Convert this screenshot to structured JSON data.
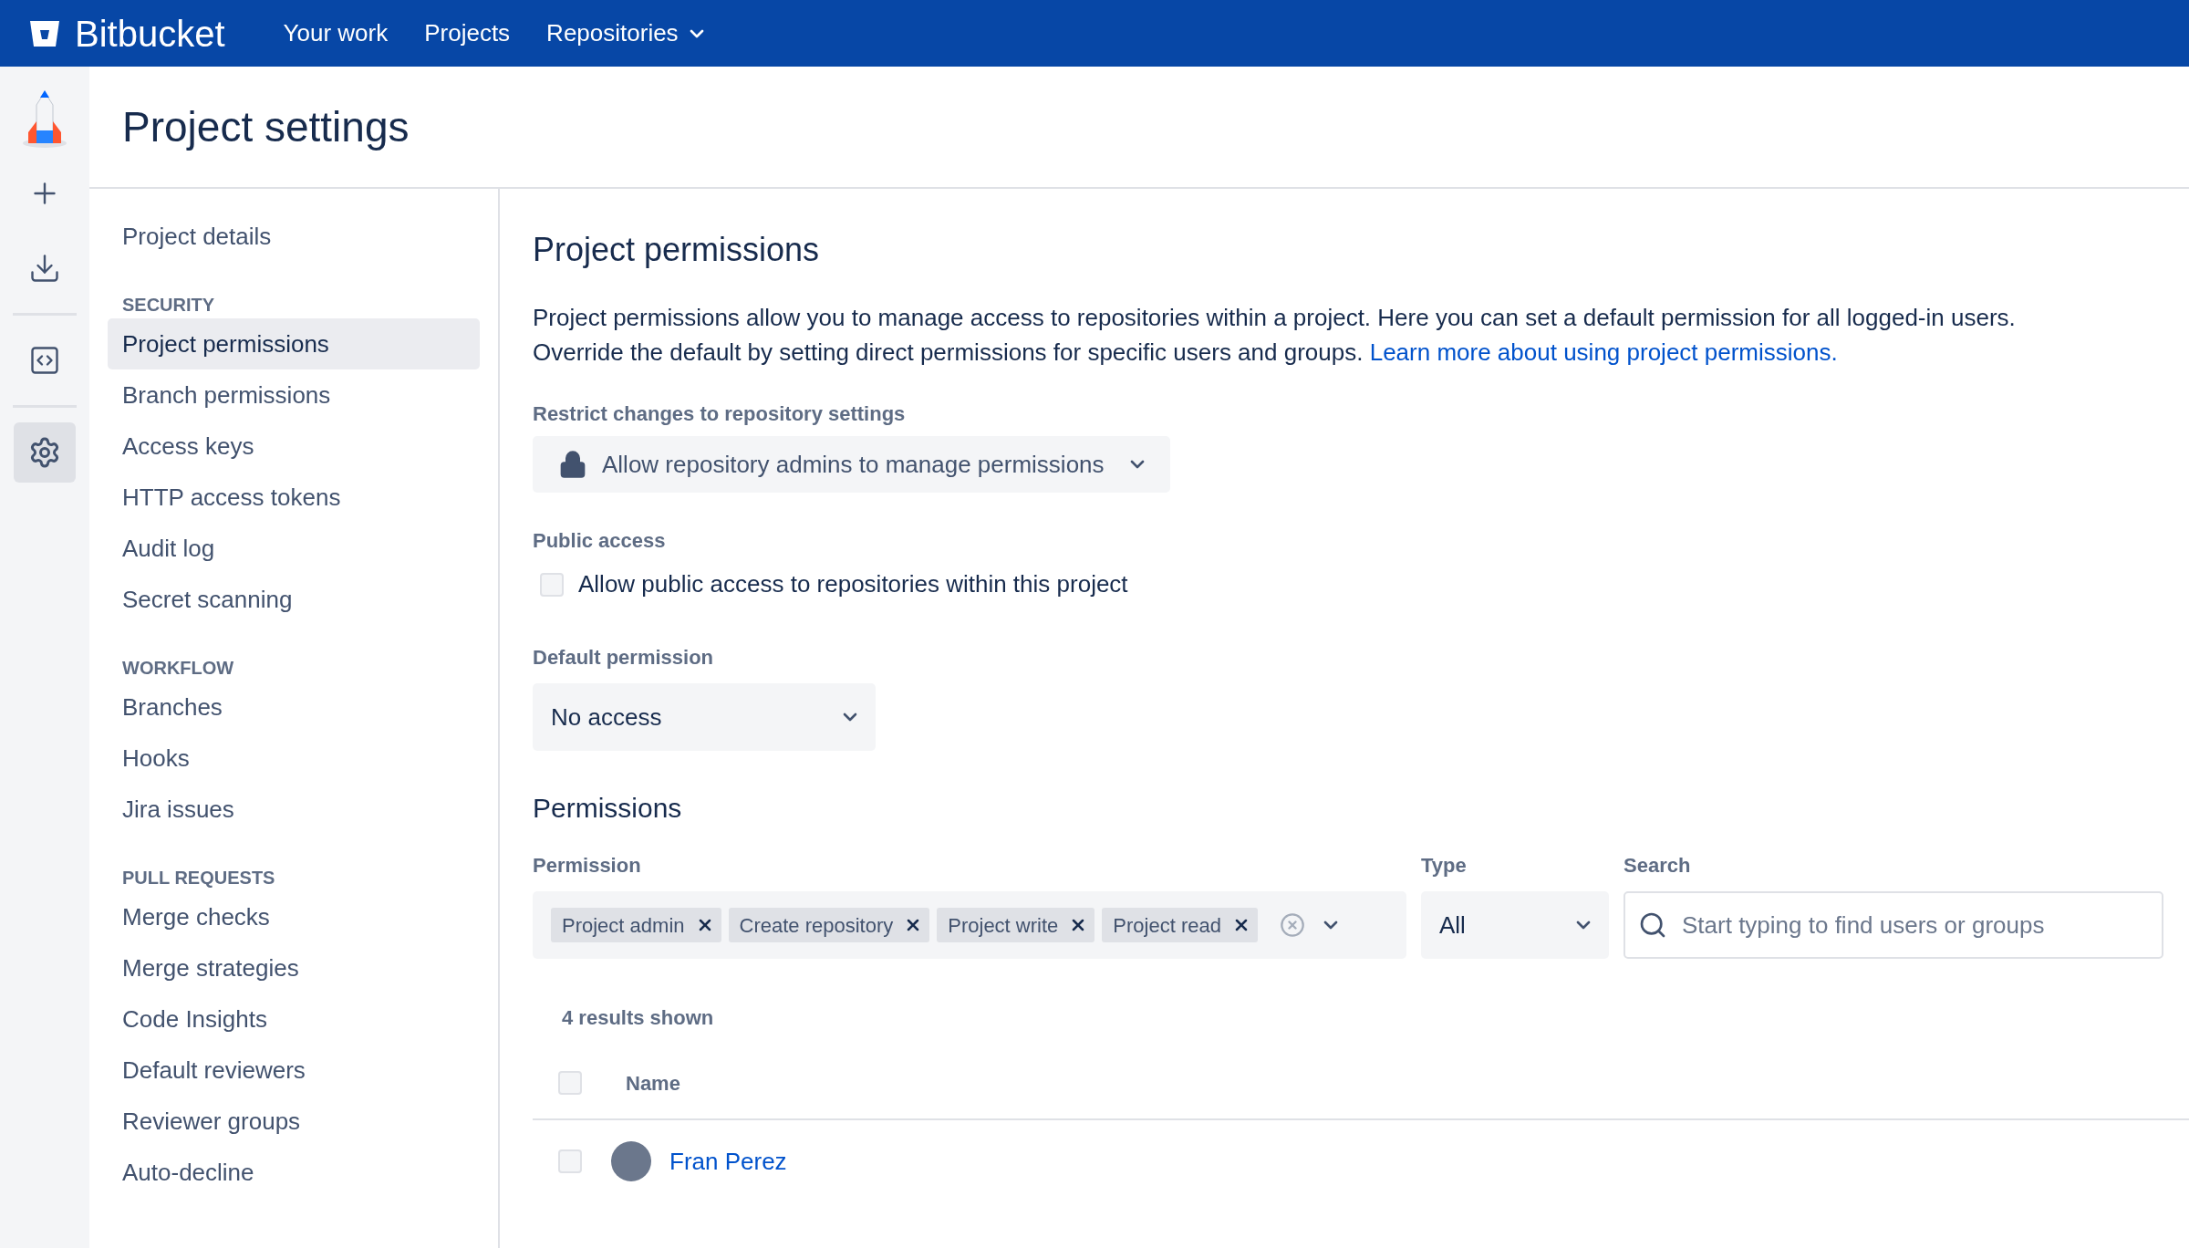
{
  "topbar": {
    "brand": "Bitbucket",
    "nav": [
      {
        "label": "Your work",
        "has_menu": false
      },
      {
        "label": "Projects",
        "has_menu": false
      },
      {
        "label": "Repositories",
        "has_menu": true
      }
    ]
  },
  "rail": {
    "items": [
      {
        "kind": "plus",
        "selected": false
      },
      {
        "kind": "download",
        "selected": false
      },
      {
        "kind": "code",
        "selected": false
      },
      {
        "kind": "gear",
        "selected": true
      }
    ]
  },
  "page_title": "Project settings",
  "settings_nav": [
    {
      "items": [
        {
          "label": "Project details",
          "selected": false
        }
      ]
    },
    {
      "heading": "SECURITY",
      "items": [
        {
          "label": "Project permissions",
          "selected": true
        },
        {
          "label": "Branch permissions",
          "selected": false
        },
        {
          "label": "Access keys",
          "selected": false
        },
        {
          "label": "HTTP access tokens",
          "selected": false
        },
        {
          "label": "Audit log",
          "selected": false
        },
        {
          "label": "Secret scanning",
          "selected": false
        }
      ]
    },
    {
      "heading": "WORKFLOW",
      "items": [
        {
          "label": "Branches",
          "selected": false
        },
        {
          "label": "Hooks",
          "selected": false
        },
        {
          "label": "Jira issues",
          "selected": false
        }
      ]
    },
    {
      "heading": "PULL REQUESTS",
      "items": [
        {
          "label": "Merge checks",
          "selected": false
        },
        {
          "label": "Merge strategies",
          "selected": false
        },
        {
          "label": "Code Insights",
          "selected": false
        },
        {
          "label": "Default reviewers",
          "selected": false
        },
        {
          "label": "Reviewer groups",
          "selected": false
        },
        {
          "label": "Auto-decline",
          "selected": false
        }
      ]
    }
  ],
  "content": {
    "title": "Project permissions",
    "description": "Project permissions allow you to manage access to repositories within a project. Here you can set a default permission for all logged-in users. Override the default by setting direct permissions for specific users and groups.",
    "learn_more_link": "Learn more about using project permissions.",
    "restrict": {
      "label": "Restrict changes to repository settings",
      "value": "Allow repository admins to manage permissions"
    },
    "public_access": {
      "label": "Public access",
      "checkbox_label": "Allow public access to repositories within this project",
      "checked": false
    },
    "default_permission": {
      "label": "Default permission",
      "value": "No access"
    },
    "permissions": {
      "title": "Permissions",
      "permission_filter": {
        "label": "Permission",
        "tags": [
          "Project admin",
          "Create repository",
          "Project write",
          "Project read"
        ]
      },
      "type_filter": {
        "label": "Type",
        "value": "All"
      },
      "search": {
        "label": "Search",
        "placeholder": "Start typing to find users or groups"
      },
      "results_count": "4 results shown",
      "table": {
        "columns": [
          "Name"
        ],
        "all_checked": false,
        "rows": [
          {
            "name": "Fran Perez",
            "checked": false
          }
        ]
      }
    }
  }
}
